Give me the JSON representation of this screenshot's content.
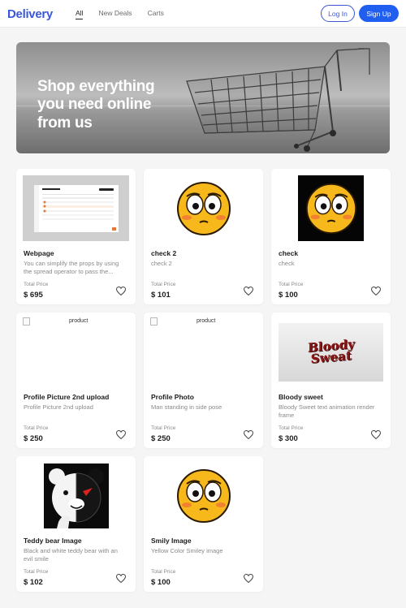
{
  "header": {
    "brand": "Delivery",
    "nav": [
      {
        "label": "All",
        "active": true
      },
      {
        "label": "New Deals",
        "active": false
      },
      {
        "label": "Carts",
        "active": false
      }
    ],
    "login_label": "Log In",
    "signup_label": "Sign Up"
  },
  "hero": {
    "title": "Shop everything\nyou need online\nfrom us"
  },
  "products": [
    {
      "name": "Webpage",
      "description": "You can simplify the props by using the spread operator to pass the...",
      "price_label": "Total Price",
      "price": "$ 695",
      "image": "webpage-screenshot"
    },
    {
      "name": "check 2",
      "description": "check 2",
      "price_label": "Total Price",
      "price": "$ 101",
      "image": "flushed-emoji"
    },
    {
      "name": "check",
      "description": "check",
      "price_label": "Total Price",
      "price": "$ 100",
      "image": "flushed-emoji-dark"
    },
    {
      "name": "Profile Picture 2nd upload",
      "description": "Profile Picture 2nd upload",
      "price_label": "Total Price",
      "price": "$ 250",
      "image": "broken-image",
      "alt": "product"
    },
    {
      "name": "Profile Photo",
      "description": "Man standing in side pose",
      "price_label": "Total Price",
      "price": "$ 250",
      "image": "broken-image",
      "alt": "product"
    },
    {
      "name": "Bloody sweet",
      "description": "Bloody Sweet text animation render frame",
      "price_label": "Total Price",
      "price": "$ 300",
      "image": "bloody-sweet-text",
      "image_text": "Bloody\nSweat"
    },
    {
      "name": "Teddy bear Image",
      "description": "Black and white teddy bear with an evil smile",
      "price_label": "Total Price",
      "price": "$ 102",
      "image": "teddy-bear"
    },
    {
      "name": "Smily Image",
      "description": "Yellow Color Smiley image",
      "price_label": "Total Price",
      "price": "$ 100",
      "image": "flushed-emoji"
    }
  ],
  "colors": {
    "brand": "#3b57d6",
    "primary_button": "#1f5ef0",
    "background": "#f5f5f5",
    "card": "#ffffff"
  },
  "icons": [
    "heart-icon",
    "broken-image-icon",
    "shopping-cart-illustration"
  ]
}
